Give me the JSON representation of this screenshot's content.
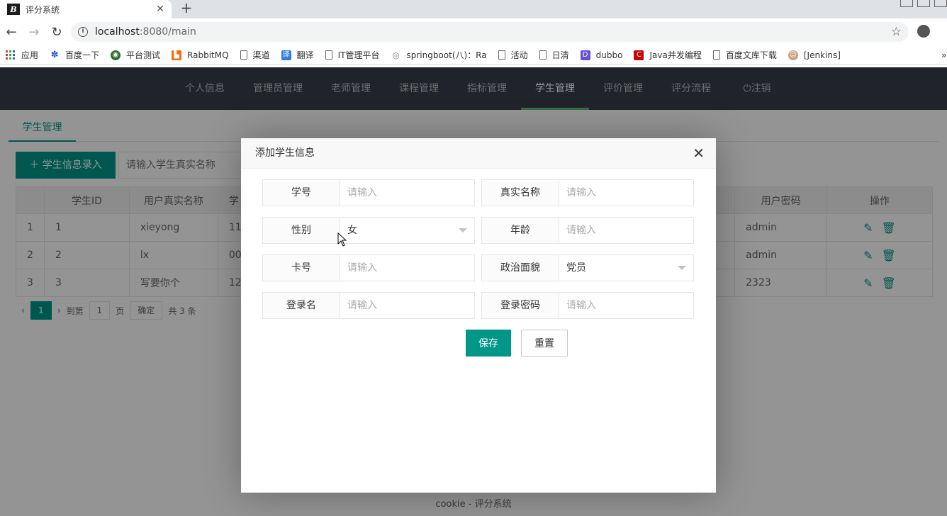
{
  "browser": {
    "tab_title": "评分系统",
    "favicon_text": "B",
    "new_tab": "+",
    "url_host": "localhost",
    "url_rest": ":8080/main",
    "bookmarks": [
      "应用",
      "百度一下",
      "平台测试",
      "RabbitMQ",
      "渠道",
      "翻译",
      "IT管理平台",
      "springboot(八)：Ra",
      "活动",
      "日清",
      "dubbo",
      "Java并发编程",
      "百度文库下载",
      "[Jenkins]"
    ],
    "bookmark_more": "»"
  },
  "nav": {
    "items": [
      "个人信息",
      "管理员管理",
      "老师管理",
      "课程管理",
      "指标管理",
      "学生管理",
      "评价管理",
      "评分流程",
      "注销"
    ]
  },
  "page": {
    "subtab": "学生管理",
    "add_button": "学生信息录入",
    "search_placeholder": "请输入学生真实名称",
    "columns": [
      "",
      "学生ID",
      "用户真实名称",
      "学",
      "用户密码",
      "操作"
    ],
    "rows": [
      {
        "idx": "1",
        "id": "1",
        "name": "xieyong",
        "no": "11",
        "pwd": "admin"
      },
      {
        "idx": "2",
        "id": "2",
        "name": "lx",
        "no": "00",
        "pwd": "admin"
      },
      {
        "idx": "3",
        "id": "3",
        "name": "写要你个",
        "no": "12",
        "pwd": "2323"
      }
    ],
    "pager": {
      "current": "1",
      "goto_label": "到第",
      "goto_value": "1",
      "page_label": "页",
      "confirm": "确定",
      "total": "共 3 条"
    },
    "footer": "cookie - 评分系统"
  },
  "dialog": {
    "title": "添加学生信息",
    "close": "✕",
    "fields": {
      "xuehao": {
        "label": "学号",
        "placeholder": "请输入"
      },
      "realname": {
        "label": "真实名称",
        "placeholder": "请输入"
      },
      "gender": {
        "label": "性别",
        "value": "女"
      },
      "age": {
        "label": "年龄",
        "placeholder": "请输入"
      },
      "card": {
        "label": "卡号",
        "placeholder": "请输入"
      },
      "political": {
        "label": "政治面貌",
        "value": "党员"
      },
      "login": {
        "label": "登录名",
        "placeholder": "请输入"
      },
      "password": {
        "label": "登录密码",
        "placeholder": "请输入"
      }
    },
    "save": "保存",
    "reset": "重置"
  }
}
